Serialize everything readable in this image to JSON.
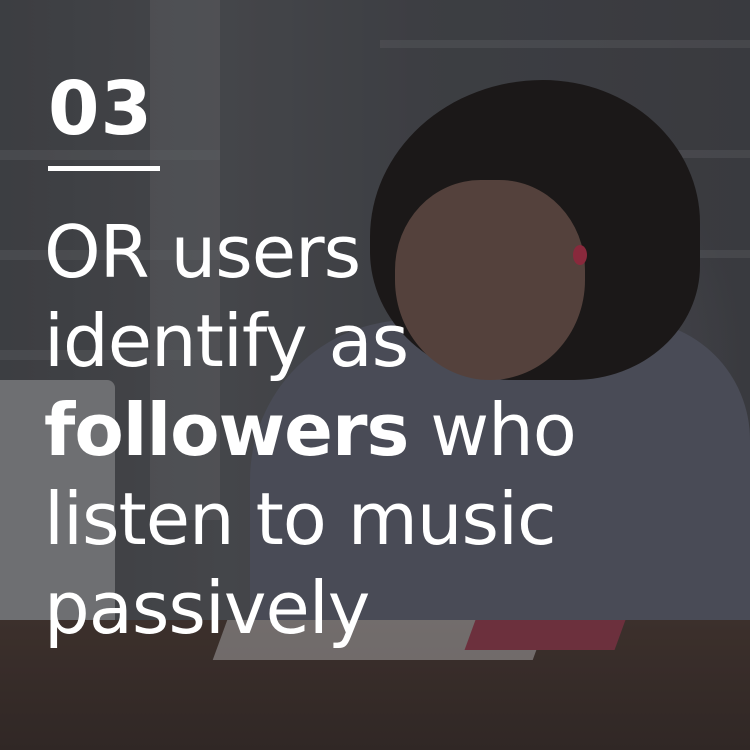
{
  "slide": {
    "number": "03",
    "headline": {
      "line1": "OR users",
      "line2": "identify as",
      "line3_bold": "followers",
      "line3_rest": " who",
      "line4": "listen to music",
      "line5": "passively"
    }
  },
  "colors": {
    "text": "#ffffff",
    "rule": "#ffffff",
    "earbud": "#b03048"
  }
}
